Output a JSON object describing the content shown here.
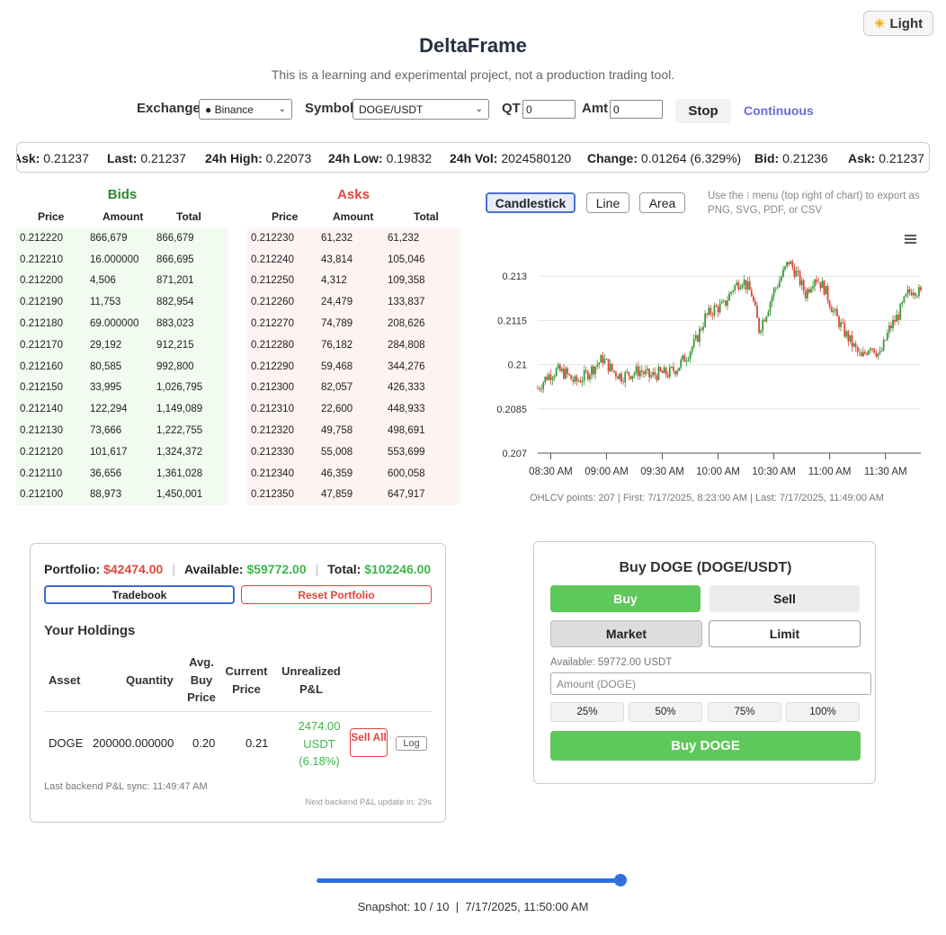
{
  "theme_button": {
    "icon": "sun-icon",
    "label": "Light"
  },
  "title": "DeltaFrame",
  "subtitle": "This is a learning and experimental project, not a production trading tool.",
  "controls": {
    "exchange_label": "Exchange",
    "exchange_value": "● Binance",
    "symbol_label": "Symbol",
    "symbol_value": "DOGE/USDT",
    "qt_label": "QT",
    "qt_value": "0",
    "amt_label": "Amt",
    "amt_value": "0",
    "stop_label": "Stop",
    "continuous_label": "Continuous"
  },
  "ticker": [
    {
      "label": "Ask:",
      "value": "0.21237"
    },
    {
      "label": "Last:",
      "value": "0.21237"
    },
    {
      "label": "24h High:",
      "value": "0.22073"
    },
    {
      "label": "24h Low:",
      "value": "0.19832"
    },
    {
      "label": "24h Vol:",
      "value": "2024580120"
    },
    {
      "label": "Change:",
      "value": "0.01264 (6.329%)"
    },
    {
      "label": "Bid:",
      "value": "0.21236"
    },
    {
      "label": "Ask:",
      "value": "0.21237"
    }
  ],
  "orderbook": {
    "headers": [
      "Price",
      "Amount",
      "Total"
    ],
    "bids_title": "Bids",
    "asks_title": "Asks",
    "bids": [
      [
        "0.212220",
        "866,679",
        "866,679"
      ],
      [
        "0.212210",
        "16.000000",
        "866,695"
      ],
      [
        "0.212200",
        "4,506",
        "871,201"
      ],
      [
        "0.212190",
        "11,753",
        "882,954"
      ],
      [
        "0.212180",
        "69.000000",
        "883,023"
      ],
      [
        "0.212170",
        "29,192",
        "912,215"
      ],
      [
        "0.212160",
        "80,585",
        "992,800"
      ],
      [
        "0.212150",
        "33,995",
        "1,026,795"
      ],
      [
        "0.212140",
        "122,294",
        "1,149,089"
      ],
      [
        "0.212130",
        "73,666",
        "1,222,755"
      ],
      [
        "0.212120",
        "101,617",
        "1,324,372"
      ],
      [
        "0.212110",
        "36,656",
        "1,361,028"
      ],
      [
        "0.212100",
        "88,973",
        "1,450,001"
      ]
    ],
    "asks": [
      [
        "0.212230",
        "61,232",
        "61,232"
      ],
      [
        "0.212240",
        "43,814",
        "105,046"
      ],
      [
        "0.212250",
        "4,312",
        "109,358"
      ],
      [
        "0.212260",
        "24,479",
        "133,837"
      ],
      [
        "0.212270",
        "74,789",
        "208,626"
      ],
      [
        "0.212280",
        "76,182",
        "284,808"
      ],
      [
        "0.212290",
        "59,468",
        "344,276"
      ],
      [
        "0.212300",
        "82,057",
        "426,333"
      ],
      [
        "0.212310",
        "22,600",
        "448,933"
      ],
      [
        "0.212320",
        "49,758",
        "498,691"
      ],
      [
        "0.212330",
        "55,008",
        "553,699"
      ],
      [
        "0.212340",
        "46,359",
        "600,058"
      ],
      [
        "0.212350",
        "47,859",
        "647,917"
      ]
    ]
  },
  "chart_types": {
    "candlestick": "Candlestick",
    "line": "Line",
    "area": "Area"
  },
  "chart_note": "Use the ⁝ menu (top right of chart) to export as PNG, SVG, PDF, or CSV",
  "chart_footer": "OHLCV points: 207 | First: 7/17/2025, 8:23:00 AM | Last: 7/17/2025, 11:49:00 AM",
  "colors": {
    "up": "#3a9a3a",
    "down": "#e0463c",
    "accent": "#2f6fe0",
    "buy": "#5ec85a"
  },
  "chart_data": {
    "type": "candlestick",
    "ylim": [
      0.207,
      0.2145
    ],
    "yticks": [
      0.207,
      0.2085,
      0.21,
      0.2115,
      0.213
    ],
    "ytick_labels": [
      "0.207",
      "0.2085",
      "0.21",
      "0.2115",
      "0.213"
    ],
    "xtick_labels": [
      "08:30 AM",
      "09:00 AM",
      "09:30 AM",
      "10:00 AM",
      "10:30 AM",
      "11:00 AM",
      "11:30 AM"
    ],
    "xtick_minutes": [
      510,
      540,
      570,
      600,
      630,
      660,
      690
    ],
    "x_range_minutes": [
      503,
      709
    ],
    "close_path": [
      [
        503,
        0.2092
      ],
      [
        508,
        0.2096
      ],
      [
        513,
        0.2098
      ],
      [
        518,
        0.2097
      ],
      [
        523,
        0.2094
      ],
      [
        528,
        0.2096
      ],
      [
        533,
        0.2099
      ],
      [
        538,
        0.2102
      ],
      [
        543,
        0.2098
      ],
      [
        548,
        0.2096
      ],
      [
        553,
        0.2097
      ],
      [
        558,
        0.2098
      ],
      [
        563,
        0.2096
      ],
      [
        568,
        0.2097
      ],
      [
        573,
        0.2097
      ],
      [
        578,
        0.2099
      ],
      [
        583,
        0.2103
      ],
      [
        588,
        0.2108
      ],
      [
        593,
        0.2116
      ],
      [
        598,
        0.2119
      ],
      [
        603,
        0.212
      ],
      [
        608,
        0.2126
      ],
      [
        613,
        0.2129
      ],
      [
        618,
        0.2124
      ],
      [
        622,
        0.2112
      ],
      [
        626,
        0.2118
      ],
      [
        630,
        0.2125
      ],
      [
        635,
        0.2131
      ],
      [
        638,
        0.2135
      ],
      [
        642,
        0.2131
      ],
      [
        647,
        0.2124
      ],
      [
        652,
        0.213
      ],
      [
        657,
        0.2126
      ],
      [
        662,
        0.2118
      ],
      [
        667,
        0.2112
      ],
      [
        672,
        0.2107
      ],
      [
        677,
        0.2102
      ],
      [
        682,
        0.2107
      ],
      [
        687,
        0.2103
      ],
      [
        692,
        0.2112
      ],
      [
        697,
        0.2117
      ],
      [
        702,
        0.2124
      ],
      [
        705,
        0.2126
      ],
      [
        709,
        0.2124
      ]
    ]
  },
  "portfolio": {
    "portfolio_label": "Portfolio:",
    "portfolio_value": "$42474.00",
    "available_label": "Available:",
    "available_value": "$59772.00",
    "total_label": "Total:",
    "total_value": "$102246.00",
    "tradebook": "Tradebook",
    "reset": "Reset Portfolio",
    "holdings_title": "Your Holdings",
    "headers": {
      "asset": "Asset",
      "quantity": "Quantity",
      "avg": "Avg. Buy Price",
      "current": "Current Price",
      "pnl": "Unrealized P&L"
    },
    "rows": [
      {
        "asset": "DOGE",
        "quantity": "200000.000000",
        "avg": "0.20",
        "current": "0.21",
        "pnl": "2474.00 USDT (6.18%)",
        "sell_all": "Sell All",
        "log": "Log"
      }
    ],
    "sync": "Last backend P&L sync: 11:49:47 AM",
    "next_update": "Next backend P&L update in: 29s"
  },
  "trade": {
    "title": "Buy DOGE (DOGE/USDT)",
    "buy": "Buy",
    "sell": "Sell",
    "market": "Market",
    "limit": "Limit",
    "available": "Available: 59772.00 USDT",
    "amount_placeholder": "Amount (DOGE)",
    "pcts": [
      "25%",
      "50%",
      "75%",
      "100%"
    ],
    "submit": "Buy DOGE"
  },
  "snapshot": {
    "progress": 1.0,
    "text": "Snapshot: 10 / 10  |  7/17/2025, 11:50:00 AM"
  }
}
